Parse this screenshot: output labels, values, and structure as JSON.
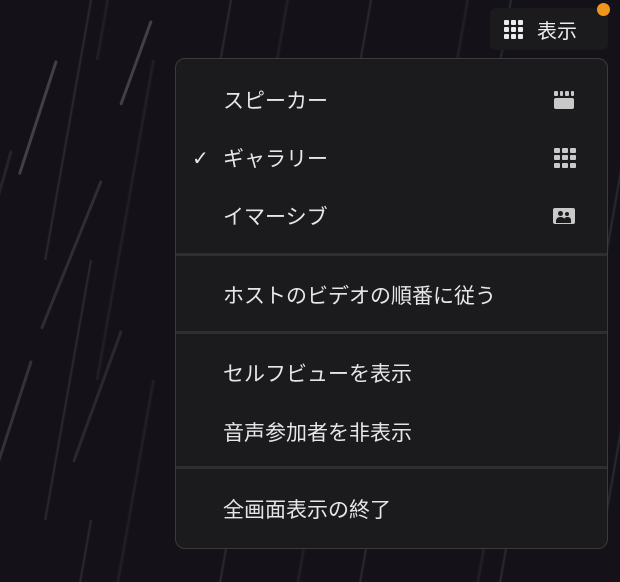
{
  "toolbar": {
    "view_label": "表示",
    "view_icon": "gallery-grid-icon",
    "notification_color": "#f0961e"
  },
  "menu": {
    "layout_items": [
      {
        "label": "スピーカー",
        "checked": false,
        "icon": "speaker-view-icon"
      },
      {
        "label": "ギャラリー",
        "checked": true,
        "icon": "gallery-view-icon"
      },
      {
        "label": "イマーシブ",
        "checked": false,
        "icon": "immersive-view-icon"
      }
    ],
    "check_mark": "✓",
    "follow_host_order": "ホストのビデオの順番に従う",
    "show_self_view": "セルフビューを表示",
    "hide_audio_participants": "音声参加者を非表示",
    "exit_fullscreen": "全画面表示の終了"
  }
}
